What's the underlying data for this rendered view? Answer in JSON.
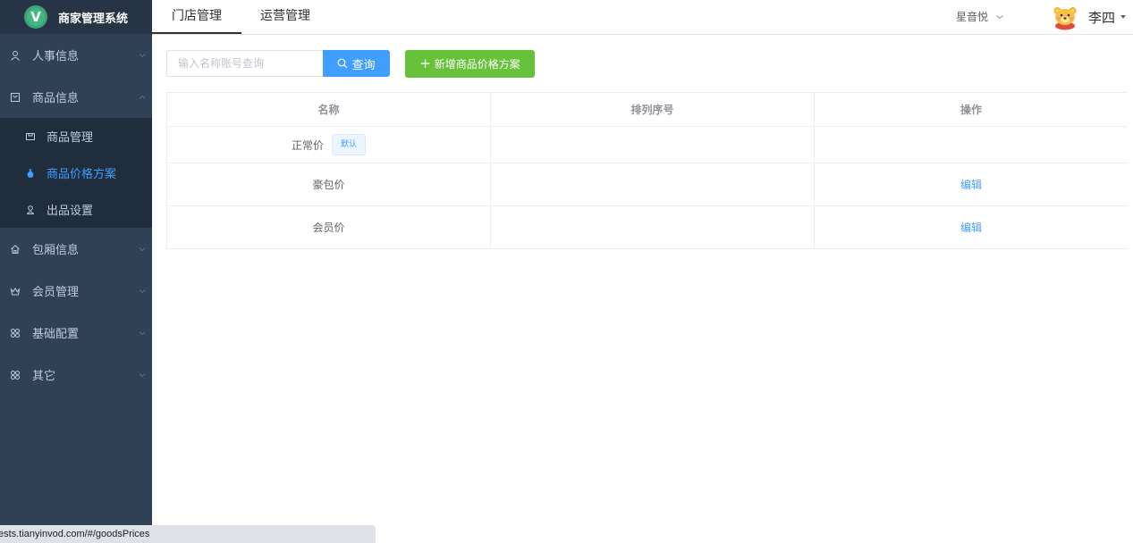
{
  "app": {
    "title": "商家管理系统",
    "logo_letter": "V"
  },
  "sidebar": {
    "items": [
      {
        "label": "人事信息",
        "icon": "user-icon"
      },
      {
        "label": "商品信息",
        "icon": "product-icon",
        "expanded": true,
        "children": [
          {
            "label": "商品管理",
            "icon": "goods-icon"
          },
          {
            "label": "商品价格方案",
            "icon": "money-bag-icon",
            "active": true
          },
          {
            "label": "出品设置",
            "icon": "person-icon"
          }
        ]
      },
      {
        "label": "包厢信息",
        "icon": "home-icon"
      },
      {
        "label": "会员管理",
        "icon": "crown-icon"
      },
      {
        "label": "基础配置",
        "icon": "grid-icon"
      },
      {
        "label": "其它",
        "icon": "grid-icon"
      }
    ]
  },
  "header": {
    "tabs": [
      {
        "label": "门店管理",
        "active": true
      },
      {
        "label": "运营管理"
      }
    ],
    "store": "星音悦",
    "user": {
      "name": "李四"
    }
  },
  "toolbar": {
    "search_placeholder": "输入名称账号查询",
    "search_value": "",
    "search_button": "查询",
    "add_button": "新增商品价格方案"
  },
  "table": {
    "columns": [
      "名称",
      "排列序号",
      "操作"
    ],
    "rows": [
      {
        "name": "正常价",
        "tag": "默认",
        "order": "",
        "action": ""
      },
      {
        "name": "豪包价",
        "order": "",
        "action": "编辑"
      },
      {
        "name": "会员价",
        "order": "",
        "action": "编辑"
      }
    ]
  },
  "statusbar": {
    "url": "tests.tianyinvod.com/#/goodsPrices"
  },
  "colors": {
    "sidebar_bg": "#304156",
    "submenu_bg": "#1f2d3d",
    "primary": "#409eff",
    "success": "#67c23a",
    "logo_green": "#41b883"
  }
}
